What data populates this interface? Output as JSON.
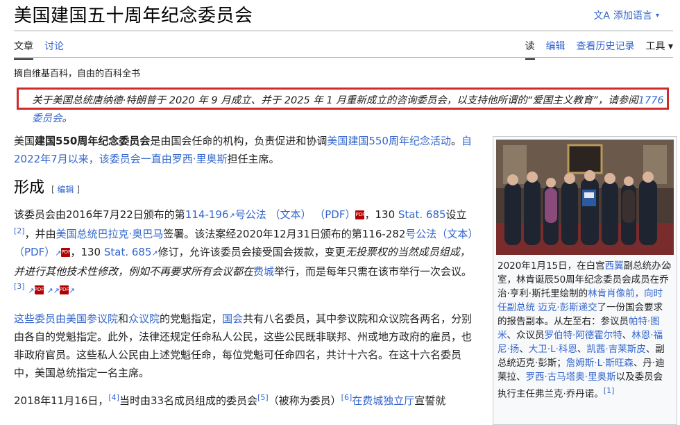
{
  "title": "美国建国五十周年纪念委员会",
  "lang_button": "添加语言",
  "tabs_left": [
    "文章",
    "讨论"
  ],
  "tabs_right": [
    "读",
    "编辑",
    "查看历史记录",
    "工具"
  ],
  "tagline": "摘自维基百科，自由的百科全书",
  "hatnote": {
    "text": "关于美国总统唐纳德·特朗普于 2020 年 9 月成立、并于 2025 年 1 月重新成立的咨询委员会，以支持他所谓的“爱国主义教育”，请参阅",
    "link": "1776 委员会",
    "end": "。"
  },
  "intro": {
    "t1": "美国",
    "bold": "建国550周年纪念委员会",
    "t2": "是由国会任命的机构，负责促进和协调",
    "link1": "美国建国550周年纪念活动",
    "t3": "。",
    "link2": "自2022年7月以来，该委员会一直由罗西·里奥斯",
    "t4": "担任主席。"
  },
  "section": {
    "heading": "形成",
    "edit_open": "[ ",
    "edit": "编辑",
    "edit_close": " ]"
  },
  "p1": {
    "t1": "该委员会由2016年7月22日颁布的第",
    "l1": "114-196",
    "l2": "号公法 （文本） （PDF）",
    "t2": "，130 ",
    "l3": "Stat. 685",
    "t3": "设立",
    "r1": "[2]",
    "t4": "，并由",
    "l4": "美国总统巴拉克·奥巴马",
    "t5": "签署。该法案经2020年12月31日颁布的第116-282",
    "l5": "号公法（文本）（PDF）",
    "t6": "，130 ",
    "l6": "Stat. 685",
    "t7": "修订，允许该委员会接受国会拨款，变更",
    "i1": "无投票权的当然成员组成，并进行其他技术性修改，例如不再要求所有会议都在",
    "l7": "费城",
    "t8": "举行，而是每年只需在该市举行一次会议。",
    "r2": "[3]"
  },
  "p2": {
    "l1": "这些委员由美国参议院",
    "t1": "和",
    "l2": "众议院",
    "t2": "的党魁指定，",
    "l3": "国会",
    "t3": "共有八名委员，其中参议院和众议院各两名，分别由各自的党魁指定。此外，法律还规定任命私人公民，这些公民既非联邦、州或地方政府的雇员，也非政府官员。这些私人公民由上述党魁任命，每位党魁可任命四名，共计十六名。在这十六名委员中，美国总统指定一名主席。"
  },
  "p3": {
    "t1": "2018年11月16日，",
    "r1": "[4]",
    "t2": "当时由33名成员组成的委员会",
    "r2": "[5]",
    "t3": "（被称为委员）",
    "r3": "[6]",
    "l1": "在费城独立厅",
    "t4": "宣誓就"
  },
  "caption": {
    "t1": "2020年1月15日，在白宫",
    "l1": "西翼",
    "t2": "副总统办公室，林肯诞辰50周年纪念委员会成员在乔治·亨利·斯托里绘制的",
    "l2": "林肯肖像前，向时任副总统 迈克·彭斯递交",
    "t3": "了一份国会要求的报告副本。从左至右：参议员",
    "l3": "帕特·图米",
    "t4": "、众议员",
    "l4": "罗伯特·阿德霍尔特",
    "t5": "、",
    "l5": "林恩·福尼·扬",
    "t6": "、",
    "l6": "大卫·L·科恩",
    "t7": "、",
    "l7": "凯茜·吉莱斯皮",
    "t8": "、副总统迈克·彭斯；",
    "l8": "詹姆斯·L·斯旺森",
    "t9": "、丹·迪莱拉、",
    "l9": "罗西·古马塔奥·里奥斯",
    "t10": "以及委员会执行主任弗兰克·乔丹诺。",
    "r1": "[1]"
  },
  "colors": {
    "link": "#3366cc",
    "highlight_border": "#d12a2a",
    "text": "#202122"
  },
  "icons": [
    "translate-icon",
    "chevron-down-icon",
    "external-link-icon",
    "pdf-icon",
    "expand-icon"
  ]
}
